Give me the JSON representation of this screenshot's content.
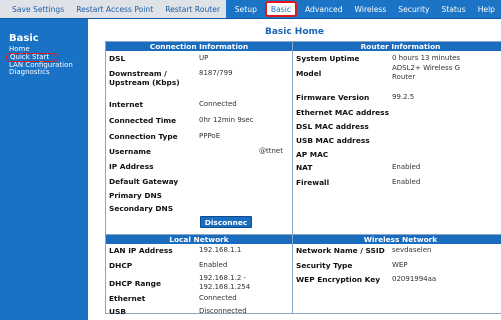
{
  "nav": {
    "left": [
      {
        "label": "Save Settings"
      },
      {
        "label": "Restart Access Point"
      },
      {
        "label": "Restart Router"
      }
    ],
    "right": [
      {
        "label": "Setup"
      },
      {
        "label": "Basic",
        "active": true
      },
      {
        "label": "Advanced"
      },
      {
        "label": "Wireless"
      },
      {
        "label": "Security"
      },
      {
        "label": "Status"
      },
      {
        "label": "Help"
      }
    ]
  },
  "sidebar": {
    "title": "Basic",
    "links": [
      {
        "label": "Home"
      },
      {
        "label": "Quick Start",
        "selected": true
      },
      {
        "label": "LAN Configuration"
      },
      {
        "label": "Diagnostics"
      }
    ]
  },
  "page": {
    "title": "Basic Home"
  },
  "connection": {
    "header": "Connection Information",
    "dsl": {
      "label": "DSL",
      "value": "UP"
    },
    "rate": {
      "label1": "Downstream /",
      "label2": "Upstream (Kbps)",
      "value": "8187/799"
    },
    "internet": {
      "label": "Internet",
      "value": "Connected"
    },
    "connected_time": {
      "label": "Connected Time",
      "value": "0hr 12min 9sec"
    },
    "connection_type": {
      "label": "Connection Type",
      "value": "PPPoE"
    },
    "username": {
      "label": "Username",
      "value": "@ttnet"
    },
    "ip_address": {
      "label": "IP Address",
      "value": ""
    },
    "default_gateway": {
      "label": "Default Gateway",
      "value": ""
    },
    "primary_dns": {
      "label": "Primary DNS",
      "value": ""
    },
    "secondary_dns": {
      "label": "Secondary DNS",
      "value": ""
    },
    "disconnect_label": "Disconnec"
  },
  "router": {
    "header": "Router Information",
    "uptime": {
      "label": "System Uptime",
      "value": "0 hours 13 minutes"
    },
    "model": {
      "label": "Model",
      "value1": "ADSL2+ Wireless G",
      "value2": "Router"
    },
    "firmware": {
      "label": "Firmware Version",
      "value": "99.2.5"
    },
    "eth_mac": {
      "label": "Ethernet MAC address",
      "value": ""
    },
    "dsl_mac": {
      "label": "DSL MAC address",
      "value": ""
    },
    "usb_mac": {
      "label": "USB MAC address",
      "value": ""
    },
    "ap_mac": {
      "label": "AP MAC",
      "value": ""
    },
    "nat": {
      "label": "NAT",
      "value": "Enabled"
    },
    "firewall": {
      "label": "Firewall",
      "value": "Enabled"
    }
  },
  "lan": {
    "header": "Local Network",
    "lan_ip": {
      "label": "LAN IP Address",
      "value": "192.168.1.1"
    },
    "dhcp": {
      "label": "DHCP",
      "value": "Enabled"
    },
    "dhcp_range": {
      "label": "DHCP Range",
      "value1": "192.168.1.2 -",
      "value2": "192.168.1.254"
    },
    "ethernet": {
      "label": "Ethernet",
      "value": "Connected"
    },
    "usb": {
      "label": "USB",
      "value": "Disconnected"
    }
  },
  "wireless": {
    "header": "Wireless Network",
    "ssid": {
      "label": "Network Name / SSID",
      "value": "sevdaselen"
    },
    "security_type": {
      "label": "Security Type",
      "value": "WEP"
    },
    "wep_key": {
      "label": "WEP Encryption Key",
      "value": "02091994aa"
    }
  },
  "colors": {
    "nav_blue": "#1b74c6",
    "panel_header": "#1a6cbf",
    "highlight_red": "#e01818",
    "nav_gray": "#dfe3e8"
  }
}
